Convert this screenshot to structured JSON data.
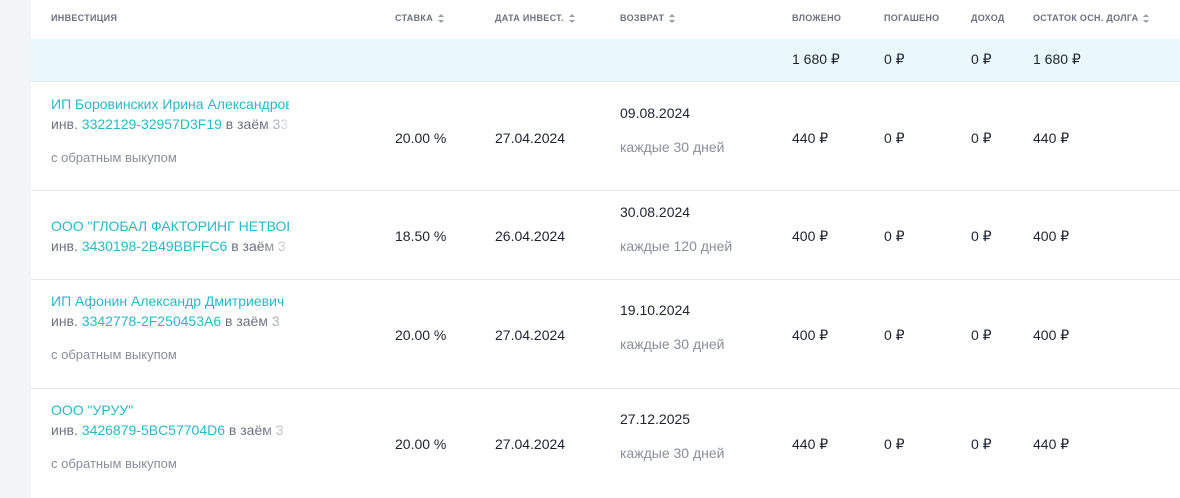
{
  "header": {
    "investment": "ИНВЕСТИЦИЯ",
    "rate": "СТАВКА",
    "date": "ДАТА ИНВЕСТ.",
    "return": "ВОЗВРАТ",
    "invested": "ВЛОЖЕНО",
    "repaid": "ПОГАШЕНО",
    "income": "ДОХОД",
    "remaining": "ОСТАТОК ОСН. ДОЛГА"
  },
  "summary": {
    "invested": "1 680 ₽",
    "repaid": "0 ₽",
    "income": "0 ₽",
    "remaining": "1 680 ₽"
  },
  "rows": [
    {
      "name": "ИП Боровинских Ирина Александровна",
      "inv_prefix": "инв.",
      "inv_id": "3322129-32957D3F19",
      "inv_suffix": "в заём 33",
      "tag": "с обратным выкупом",
      "rate": "20.00 %",
      "date": "27.04.2024",
      "return_date": "09.08.2024",
      "return_freq": "каждые 30 дней",
      "invested": "440 ₽",
      "repaid": "0 ₽",
      "income": "0 ₽",
      "remaining": "440 ₽"
    },
    {
      "name": "ООО \"ГЛОБАЛ ФАКТОРИНГ НЕТВОРК\"",
      "inv_prefix": "инв.",
      "inv_id": "3430198-2B49BBFFC6",
      "inv_suffix": "в заём 3",
      "tag": "",
      "rate": "18.50 %",
      "date": "26.04.2024",
      "return_date": "30.08.2024",
      "return_freq": "каждые 120 дней",
      "invested": "400 ₽",
      "repaid": "0 ₽",
      "income": "0 ₽",
      "remaining": "400 ₽"
    },
    {
      "name": "ИП Афонин Александр Дмитриевич",
      "inv_prefix": "инв.",
      "inv_id": "3342778-2F250453A6",
      "inv_suffix": "в заём 3",
      "tag": "с обратным выкупом",
      "rate": "20.00 %",
      "date": "27.04.2024",
      "return_date": "19.10.2024",
      "return_freq": "каждые 30 дней",
      "invested": "400 ₽",
      "repaid": "0 ₽",
      "income": "0 ₽",
      "remaining": "400 ₽"
    },
    {
      "name": "ООО \"УРУУ\"",
      "inv_prefix": "инв.",
      "inv_id": "3426879-5BC57704D6",
      "inv_suffix": "в заём 3",
      "tag": "с обратным выкупом",
      "rate": "20.00 %",
      "date": "27.04.2024",
      "return_date": "27.12.2025",
      "return_freq": "каждые 30 дней",
      "invested": "440 ₽",
      "repaid": "0 ₽",
      "income": "0 ₽",
      "remaining": "440 ₽"
    }
  ]
}
